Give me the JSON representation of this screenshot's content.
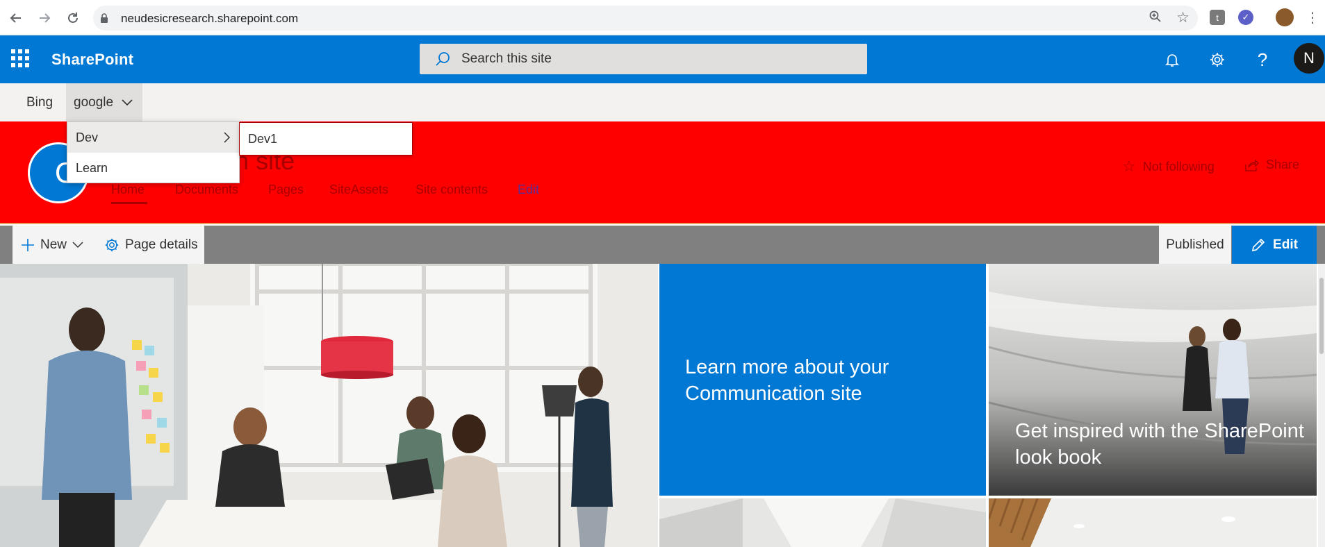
{
  "browser": {
    "url": "neudesicresearch.sharepoint.com",
    "extensions": [
      "t"
    ]
  },
  "suite": {
    "brand": "SharePoint",
    "search_placeholder": "Search this site",
    "avatar_initial": "N",
    "accent": "#0078d4"
  },
  "hub_nav": {
    "items": [
      {
        "label": "Bing"
      },
      {
        "label": "google"
      }
    ]
  },
  "dropdown": {
    "items": [
      {
        "label": "Dev"
      },
      {
        "label": "Learn"
      }
    ],
    "submenu": [
      {
        "label": "Dev1"
      }
    ]
  },
  "site": {
    "logo_letter": "C",
    "title_visible": "ation site",
    "header_color": "#ff0000",
    "nav": [
      {
        "label": "Home"
      },
      {
        "label": "Documents"
      },
      {
        "label": "Pages"
      },
      {
        "label": "SiteAssets"
      },
      {
        "label": "Site contents"
      },
      {
        "label": "Edit"
      }
    ],
    "not_following": "Not following",
    "share": "Share"
  },
  "command_bar": {
    "new_label": "New",
    "page_details_label": "Page details",
    "status": "Published",
    "edit_label": "Edit"
  },
  "hero": {
    "tile_learn": "Learn more about your Communication site",
    "tile_lookbook": "Get inspired with the SharePoint look book"
  }
}
